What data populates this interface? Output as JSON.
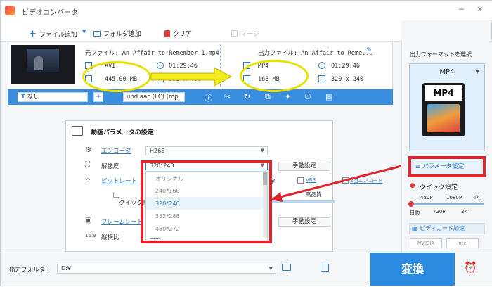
{
  "window": {
    "title": "ビデオコンバータ",
    "minimize": "─",
    "close": "✕"
  },
  "toolbar": {
    "add_file": "ファイル追加",
    "add_folder": "フォルダ追加",
    "clear": "クリア",
    "merge": "マージ"
  },
  "file": {
    "source_label": "元ファイル: An Affair to Remember 1.mp4",
    "source_format": "AVI",
    "source_duration": "01:29:46",
    "source_size": "445.00 MB",
    "source_resolution": "352 x 480",
    "output_label": "出力ファイル: An Affair to Reme...",
    "output_format": "MP4",
    "output_duration": "01:29:46",
    "output_size": "168 MB",
    "output_resolution": "320 x 240"
  },
  "options_bar": {
    "subtitle": "なし",
    "audio": "und aac (LC) (mp"
  },
  "param_dialog": {
    "title": "動画パラメータの設定",
    "encoder_label": "エンコーダ",
    "encoder_value": "H265",
    "resolution_label": "解像度",
    "resolution_value": "320*240",
    "manual_button": "手動設定",
    "bitrate_label": "ビットレート",
    "quick_label": "クイック設定",
    "vbr": "VBR",
    "twopass": "2回エンコード",
    "quality": "高品質",
    "framerate_label": "フレームレート",
    "manual_button_2": "手動設定",
    "aspect_label": "縦横比",
    "aspect_value": "自動",
    "partial_text": "定",
    "options": [
      "オリジナル",
      "240*160",
      "320*240",
      "352*288",
      "480*272"
    ]
  },
  "sidebar": {
    "heading": "出力フォーマットを選択",
    "format": "MP4",
    "param_button": "パラメータ設定",
    "quick_setting": "クイック設定",
    "ticks_top": [
      "480P",
      "1080P",
      "4K"
    ],
    "ticks_bottom": [
      "自動",
      "720P",
      "2K"
    ],
    "gpu_title": "ビデオカード加速",
    "gpu_vendors": [
      "NVIDIA",
      "intel"
    ]
  },
  "bottom": {
    "output_folder_label": "出力フォルダ:",
    "output_folder_value": "D:¥",
    "convert": "変換"
  }
}
